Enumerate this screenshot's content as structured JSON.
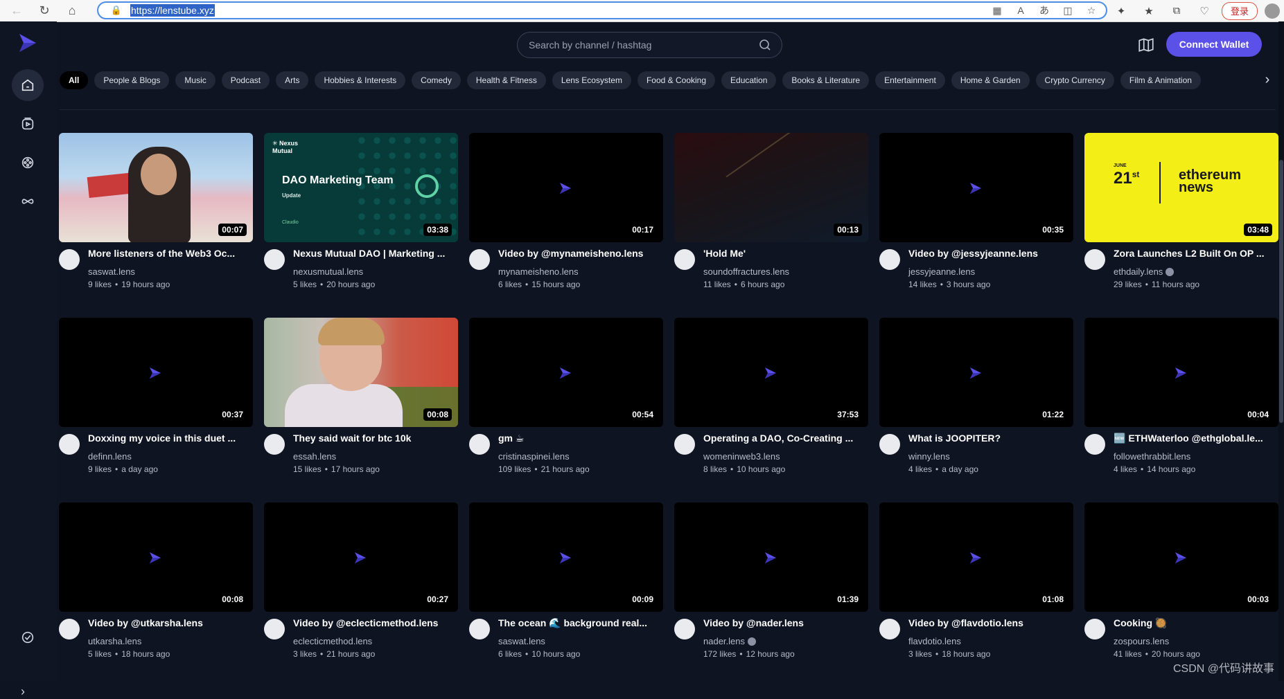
{
  "browser": {
    "url": "https://lenstube.xyz",
    "login_label": "登录"
  },
  "header": {
    "search_placeholder": "Search by channel / hashtag",
    "connect_label": "Connect Wallet"
  },
  "categories": [
    "All",
    "People & Blogs",
    "Music",
    "Podcast",
    "Arts",
    "Hobbies & Interests",
    "Comedy",
    "Health & Fitness",
    "Lens Ecosystem",
    "Food & Cooking",
    "Education",
    "Books & Literature",
    "Entertainment",
    "Home & Garden",
    "Crypto Currency",
    "Film & Animation"
  ],
  "videos": [
    {
      "title": "More listeners of the Web3 Oc...",
      "channel": "saswat.lens",
      "likes": "9 likes",
      "time": "19 hours ago",
      "duration": "00:07",
      "thumb": "beach",
      "verified": false
    },
    {
      "title": "Nexus Mutual DAO | Marketing ...",
      "channel": "nexusmutual.lens",
      "likes": "5 likes",
      "time": "20 hours ago",
      "duration": "03:38",
      "thumb": "nexus",
      "verified": false
    },
    {
      "title": "Video by @mynameisheno.lens",
      "channel": "mynameisheno.lens",
      "likes": "6 likes",
      "time": "15 hours ago",
      "duration": "00:17",
      "thumb": "black",
      "verified": false
    },
    {
      "title": "'Hold Me'",
      "channel": "soundoffractures.lens",
      "likes": "11 likes",
      "time": "6 hours ago",
      "duration": "00:13",
      "thumb": "hold",
      "verified": false
    },
    {
      "title": "Video by @jessyjeanne.lens",
      "channel": "jessyjeanne.lens",
      "likes": "14 likes",
      "time": "3 hours ago",
      "duration": "00:35",
      "thumb": "black",
      "verified": false
    },
    {
      "title": "Zora Launches L2 Built On OP ...",
      "channel": "ethdaily.lens",
      "likes": "29 likes",
      "time": "11 hours ago",
      "duration": "03:48",
      "thumb": "eth",
      "verified": true
    },
    {
      "title": "Doxxing my voice in this duet ...",
      "channel": "definn.lens",
      "likes": "9 likes",
      "time": "a day ago",
      "duration": "00:37",
      "thumb": "black",
      "verified": false
    },
    {
      "title": "They said wait for btc 10k",
      "channel": "essah.lens",
      "likes": "15 likes",
      "time": "17 hours ago",
      "duration": "00:08",
      "thumb": "boy",
      "verified": false
    },
    {
      "title": "gm ☕",
      "channel": "cristinaspinei.lens",
      "likes": "109 likes",
      "time": "21 hours ago",
      "duration": "00:54",
      "thumb": "black",
      "verified": false
    },
    {
      "title": "Operating a DAO, Co-Creating ...",
      "channel": "womeninweb3.lens",
      "likes": "8 likes",
      "time": "10 hours ago",
      "duration": "37:53",
      "thumb": "black",
      "verified": false
    },
    {
      "title": "What is JOOPITER?",
      "channel": "winny.lens",
      "likes": "4 likes",
      "time": "a day ago",
      "duration": "01:22",
      "thumb": "black",
      "verified": false
    },
    {
      "title": "🆕 ETHWaterloo @ethglobal.le...",
      "channel": "followethrabbit.lens",
      "likes": "4 likes",
      "time": "14 hours ago",
      "duration": "00:04",
      "thumb": "black",
      "verified": false
    },
    {
      "title": "Video by @utkarsha.lens",
      "channel": "utkarsha.lens",
      "likes": "5 likes",
      "time": "18 hours ago",
      "duration": "00:08",
      "thumb": "black",
      "verified": false
    },
    {
      "title": "Video by @eclecticmethod.lens",
      "channel": "eclecticmethod.lens",
      "likes": "3 likes",
      "time": "21 hours ago",
      "duration": "00:27",
      "thumb": "black",
      "verified": false
    },
    {
      "title": "The ocean 🌊 background real...",
      "channel": "saswat.lens",
      "likes": "6 likes",
      "time": "10 hours ago",
      "duration": "00:09",
      "thumb": "black",
      "verified": false
    },
    {
      "title": "Video by @nader.lens",
      "channel": "nader.lens",
      "likes": "172 likes",
      "time": "12 hours ago",
      "duration": "01:39",
      "thumb": "black",
      "verified": true
    },
    {
      "title": "Video by @flavdotio.lens",
      "channel": "flavdotio.lens",
      "likes": "3 likes",
      "time": "18 hours ago",
      "duration": "01:08",
      "thumb": "black",
      "verified": false
    },
    {
      "title": "Cooking 🥘",
      "channel": "zospours.lens",
      "likes": "41 likes",
      "time": "20 hours ago",
      "duration": "00:03",
      "thumb": "black",
      "verified": false
    }
  ],
  "watermark": "CSDN @代码讲故事",
  "colors": {
    "accent": "#5b50e8",
    "background": "#0f1422",
    "chip": "#222838"
  }
}
